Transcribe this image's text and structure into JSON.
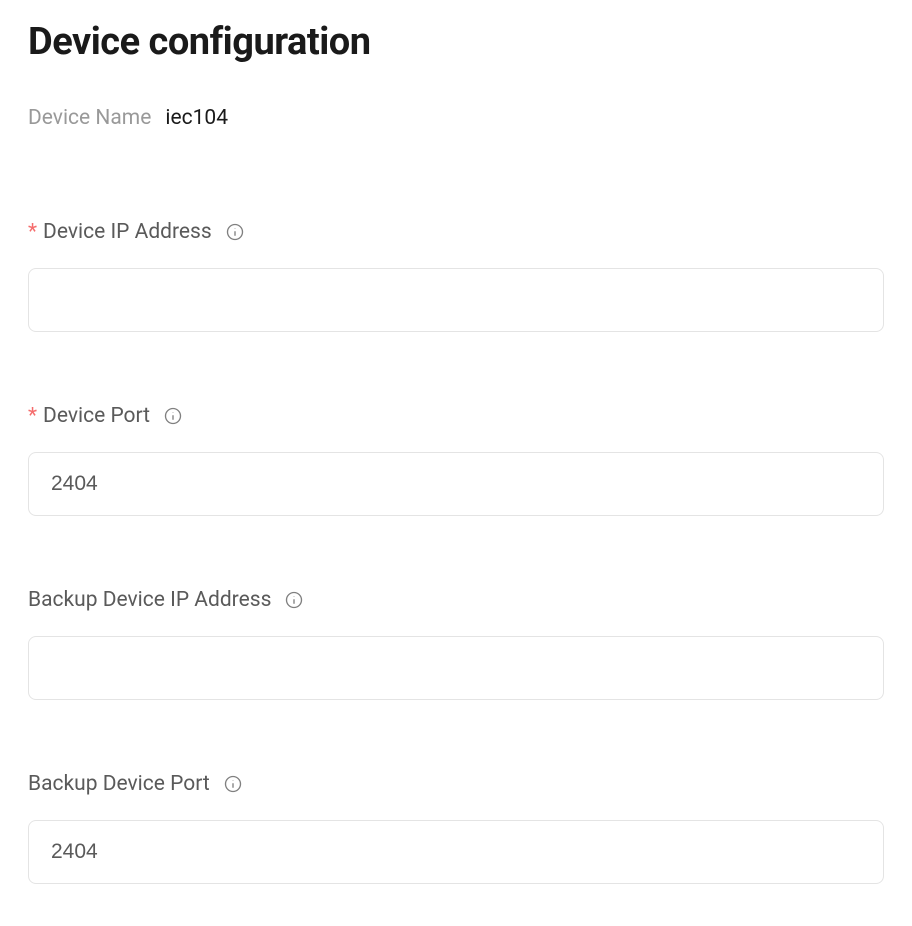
{
  "page": {
    "title": "Device configuration"
  },
  "meta": {
    "device_name_label": "Device Name",
    "device_name_value": "iec104"
  },
  "form": {
    "device_ip": {
      "label": "Device IP Address",
      "value": "",
      "required": true
    },
    "device_port": {
      "label": "Device Port",
      "value": "2404",
      "required": true
    },
    "backup_ip": {
      "label": "Backup Device IP Address",
      "value": "",
      "required": false
    },
    "backup_port": {
      "label": "Backup Device Port",
      "value": "2404",
      "required": false
    }
  }
}
